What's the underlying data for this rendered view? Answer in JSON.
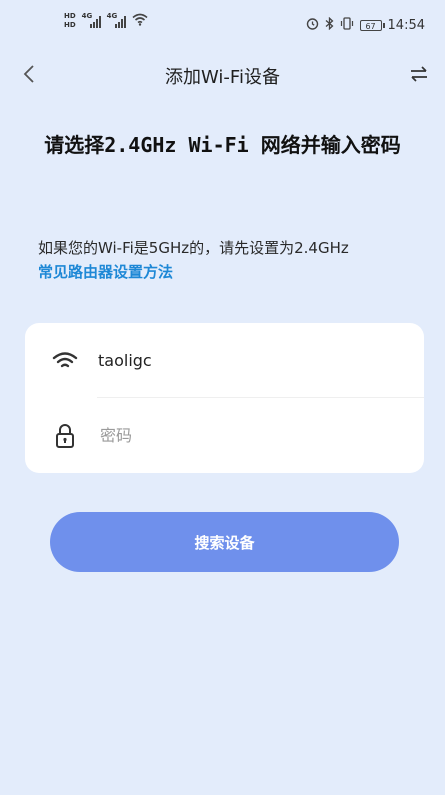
{
  "status_bar": {
    "hd_labels": [
      "HD",
      "HD"
    ],
    "network_1": "4G",
    "network_2": "4G",
    "battery_level": "67",
    "time": "14:54"
  },
  "nav": {
    "title": "添加Wi-Fi设备"
  },
  "headline": "请选择2.4GHz Wi-Fi 网络并输入密码",
  "hint": "如果您的Wi-Fi是5GHz的，请先设置为2.4GHz",
  "help_link": "常见路由器设置方法",
  "form": {
    "ssid": "taoligc",
    "password_value": "",
    "password_placeholder": "密码"
  },
  "search_button_label": "搜索设备",
  "colors": {
    "background": "#e3ecfb",
    "accent_button": "#6f90ec",
    "link": "#1e88d6",
    "card": "#ffffff"
  }
}
